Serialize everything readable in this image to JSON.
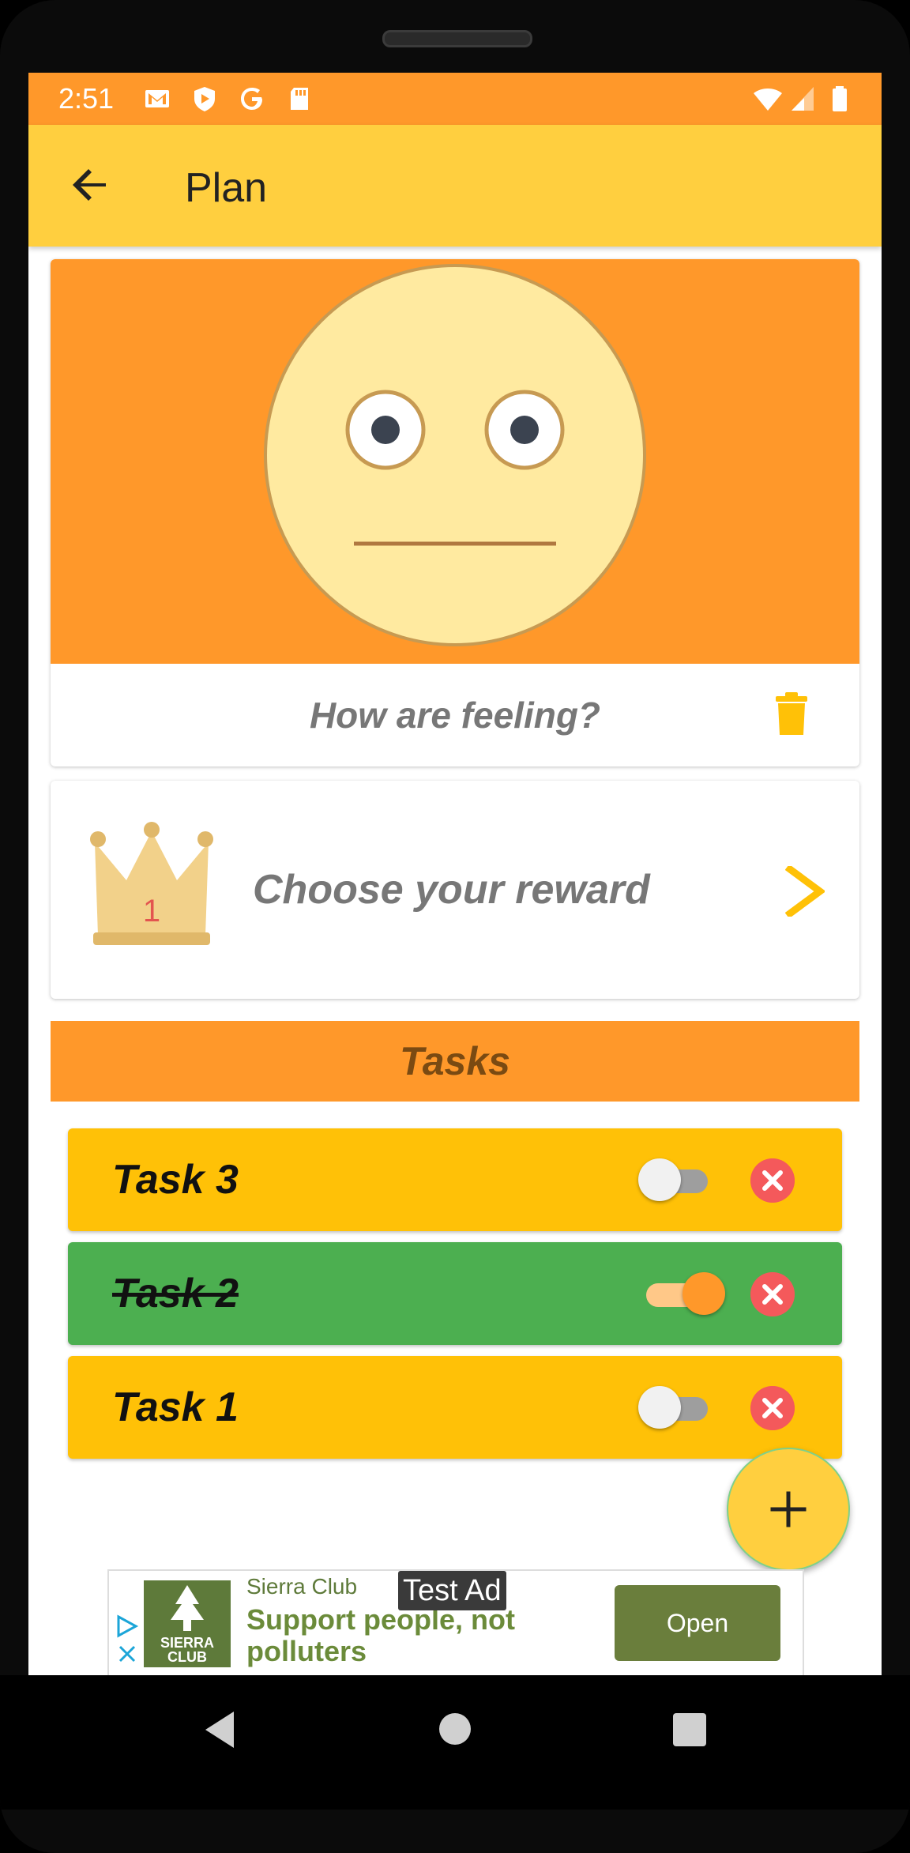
{
  "status_bar": {
    "time": "2:51",
    "left_icons": [
      "gmail-icon",
      "shield-icon",
      "google-icon",
      "sd-card-icon"
    ],
    "right_icons": [
      "wifi-icon",
      "signal-icon",
      "battery-icon"
    ]
  },
  "app_bar": {
    "title": "Plan",
    "back_icon": "arrow-left-icon",
    "background": "#FFCF3F"
  },
  "mood_card": {
    "prompt": "How are feeling?",
    "face": "neutral-face",
    "delete_icon": "trash-icon",
    "background": "#FF982A"
  },
  "reward_card": {
    "label": "Choose your reward",
    "crown_number": "1",
    "chevron_icon": "chevron-right-icon"
  },
  "tasks_section": {
    "header": "Tasks",
    "items": [
      {
        "name": "Task 3",
        "done": false,
        "color": "#FFC107"
      },
      {
        "name": "Task 2",
        "done": true,
        "color": "#4CAF50"
      },
      {
        "name": "Task 1",
        "done": false,
        "color": "#FFC107"
      }
    ]
  },
  "fab": {
    "icon": "plus-icon"
  },
  "ad": {
    "tag": "Test Ad",
    "advertiser": "Sierra Club",
    "logo_text": "SIERRA CLUB",
    "headline": "Support people, not polluters",
    "button": "Open"
  },
  "nav_bar": {
    "icons": [
      "back-triangle-icon",
      "home-circle-icon",
      "recents-square-icon"
    ]
  },
  "colors": {
    "accent": "#FF982A",
    "primary": "#FFCF3F",
    "delete": "#F4595B"
  }
}
